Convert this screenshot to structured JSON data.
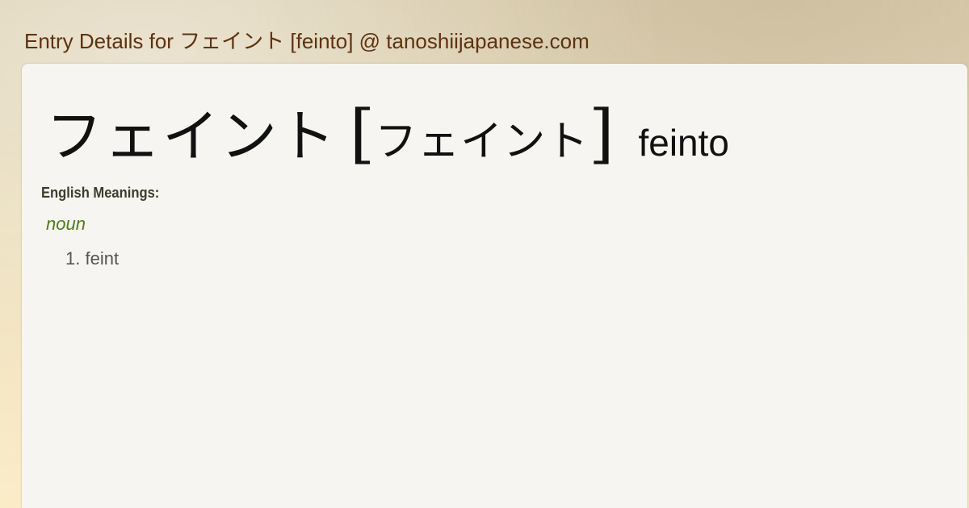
{
  "header": {
    "title": "Entry Details for フェイント [feinto] @ tanoshiijapanese.com"
  },
  "entry": {
    "headword": "フェイント",
    "bracket_open": "[",
    "reading": "フェイント",
    "bracket_close": "]",
    "romaji": "feinto"
  },
  "meanings": {
    "label": "English Meanings:",
    "part_of_speech": "noun",
    "senses": [
      {
        "number": "1.",
        "text": "feint"
      }
    ]
  }
}
